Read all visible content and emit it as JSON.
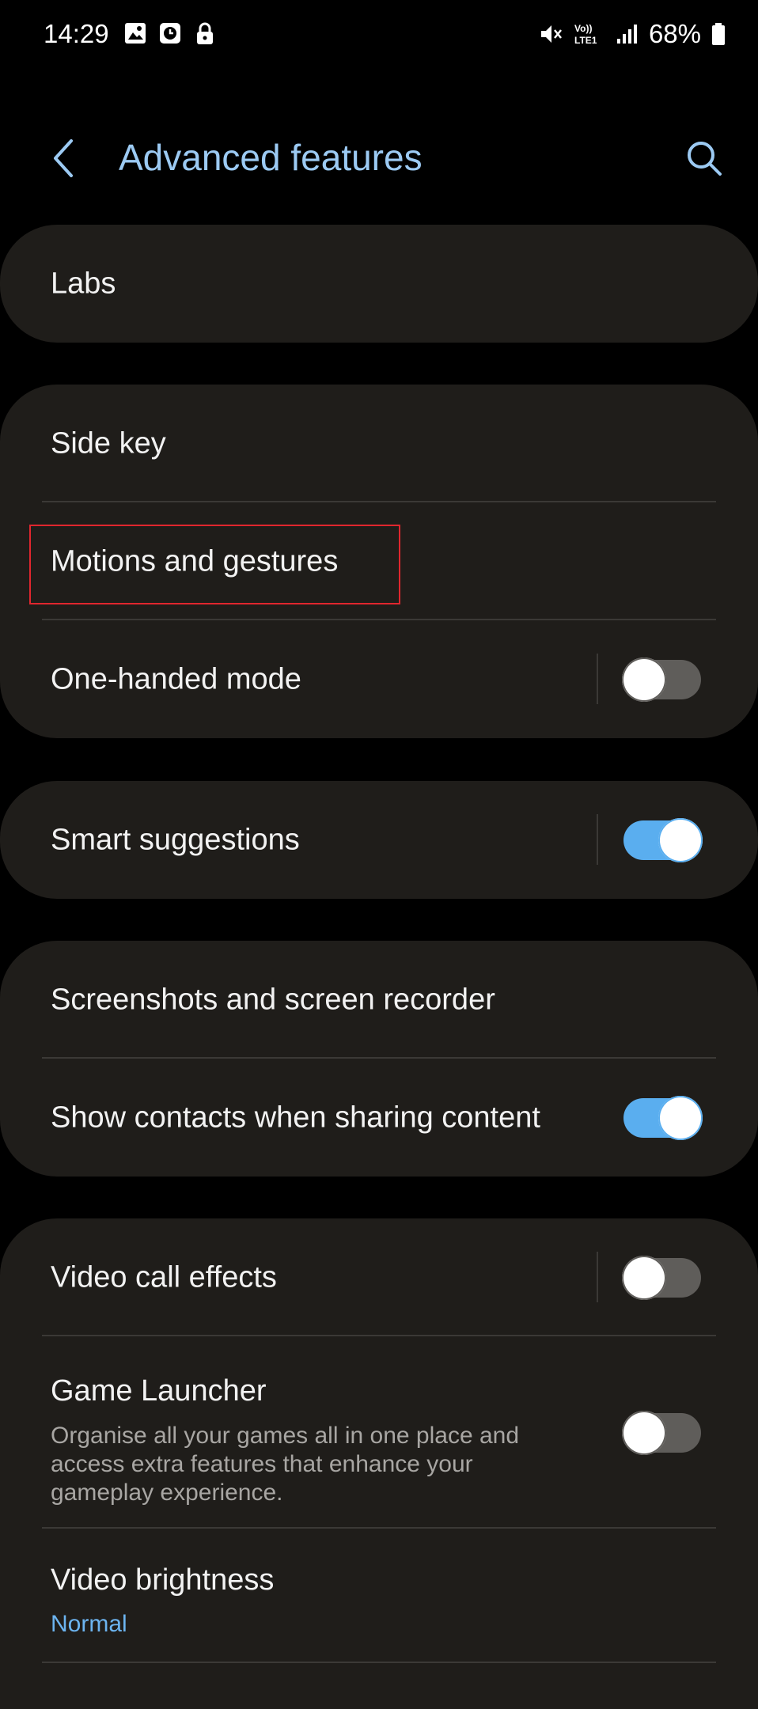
{
  "status_bar": {
    "time": "14:29",
    "battery": "68%",
    "left_icons": [
      "gallery-icon",
      "clock-icon",
      "lock-icon"
    ],
    "right_icons": [
      "mute-icon",
      "volte-icon",
      "signal-icon",
      "battery-icon"
    ]
  },
  "header": {
    "title": "Advanced features",
    "back_icon": "chevron-left-icon",
    "search_icon": "search-icon"
  },
  "colors": {
    "accent": "#9ccaf3",
    "toggle_on": "#5aaeef",
    "card_bg": "#1f1d1a",
    "highlight_box": "#e0262e"
  },
  "groups": [
    {
      "items": [
        {
          "label": "Labs"
        }
      ]
    },
    {
      "items": [
        {
          "label": "Side key"
        },
        {
          "label": "Motions and gestures"
        },
        {
          "label": "One-handed mode",
          "toggle": false
        }
      ]
    },
    {
      "items": [
        {
          "label": "Smart suggestions",
          "toggle": true
        }
      ]
    },
    {
      "items": [
        {
          "label": "Screenshots and screen recorder"
        },
        {
          "label": "Show contacts when sharing content",
          "toggle": true
        }
      ]
    },
    {
      "items": [
        {
          "label": "Video call effects",
          "toggle": false
        },
        {
          "label": "Game Launcher",
          "description": "Organise all your games all in one place and access extra features that enhance your gameplay experience.",
          "toggle": false
        },
        {
          "label": "Video brightness",
          "value": "Normal"
        }
      ]
    }
  ]
}
